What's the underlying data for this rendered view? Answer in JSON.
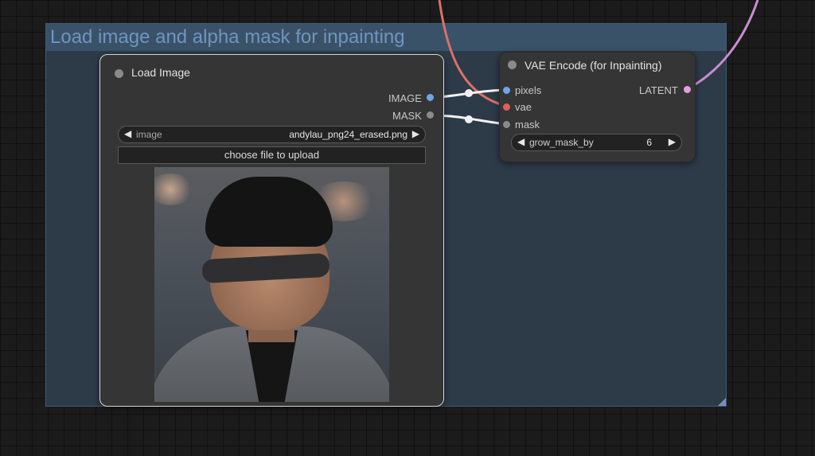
{
  "group": {
    "title": "Load image and alpha mask for inpainting",
    "color": "#6f95bf"
  },
  "load_image_node": {
    "title": "Load Image",
    "outputs": [
      {
        "label": "IMAGE",
        "color": "#6fa6e8"
      },
      {
        "label": "MASK",
        "color": "#8a8a8a"
      }
    ],
    "image_widget": {
      "name": "image",
      "value": "andylau_png24_erased.png"
    },
    "upload_button": "choose file to upload",
    "preview_icon": "image-preview"
  },
  "vae_node": {
    "title": "VAE Encode (for Inpainting)",
    "inputs": [
      {
        "label": "pixels",
        "color": "#6fa6e8"
      },
      {
        "label": "vae",
        "color": "#e0605a"
      },
      {
        "label": "mask",
        "color": "#8a8a8a"
      }
    ],
    "output": {
      "label": "LATENT",
      "color": "#e39de0"
    },
    "grow_widget": {
      "name": "grow_mask_by",
      "value": "6"
    }
  },
  "link_colors": {
    "image": "#f2f2f2",
    "mask": "#f2f2f2",
    "vae": "#d9706a",
    "latent": "#c98ed0"
  }
}
